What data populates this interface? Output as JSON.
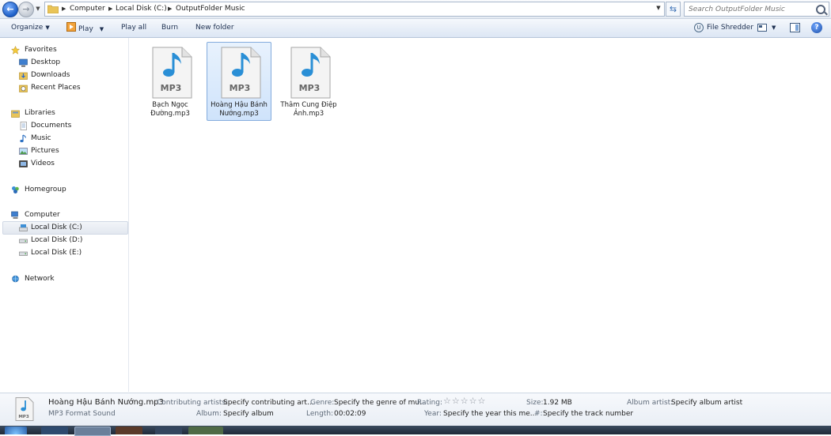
{
  "address": {
    "crumbs": [
      "Computer",
      "Local Disk (C:)",
      "OutputFolder Music"
    ],
    "search_placeholder": "Search OutputFolder Music"
  },
  "toolbar": {
    "organize": "Organize",
    "play": "Play",
    "play_all": "Play all",
    "burn": "Burn",
    "new_folder": "New folder",
    "file_shredder": "File Shredder"
  },
  "nav": {
    "favorites": "Favorites",
    "desktop": "Desktop",
    "downloads": "Downloads",
    "recent_places": "Recent Places",
    "libraries": "Libraries",
    "documents": "Documents",
    "music": "Music",
    "pictures": "Pictures",
    "videos": "Videos",
    "homegroup": "Homegroup",
    "computer": "Computer",
    "local_c": "Local Disk (C:)",
    "local_d": "Local Disk (D:)",
    "local_e": "Local Disk (E:)",
    "network": "Network"
  },
  "files": [
    {
      "line1": "Bạch Ngọc",
      "line2": "Đường.mp3",
      "icon_label": "MP3"
    },
    {
      "line1": "Hoàng Hậu Bánh",
      "line2": "Nướng.mp3",
      "icon_label": "MP3",
      "selected": true
    },
    {
      "line1": "Thâm Cung Điệp",
      "line2": "Ảnh.mp3",
      "icon_label": "MP3"
    }
  ],
  "details": {
    "filename": "Hoàng Hậu Bánh Nướng.mp3",
    "filetype": "MP3 Format Sound",
    "thumb_label": "MP3",
    "contrib_label": "Contributing artists:",
    "contrib_value": "Specify contributing art...",
    "album_label": "Album:",
    "album_value": "Specify album",
    "genre_label": "Genre:",
    "genre_value": "Specify the genre of mu...",
    "length_label": "Length:",
    "length_value": "00:02:09",
    "rating_label": "Rating:",
    "rating_stars": "☆☆☆☆☆",
    "year_label": "Year:",
    "year_value": "Specify the year this me...",
    "size_label": "Size:",
    "size_value": "1.92 MB",
    "track_label": "#:",
    "track_value": "Specify the track number",
    "album_artist_label": "Album artist:",
    "album_artist_value": "Specify album artist"
  },
  "colors": {
    "selection_bg": "#cfe3fb",
    "selection_border": "#84acdd",
    "note_blue": "#2a8fd6",
    "toolbar_bg": "#dce6f4"
  }
}
